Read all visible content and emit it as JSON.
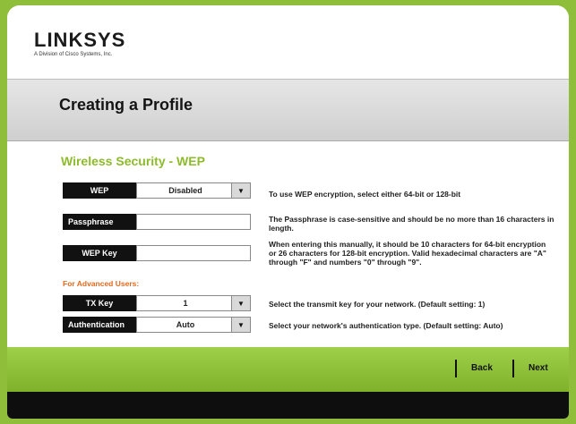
{
  "brand": {
    "name": "LINKSYS",
    "tagline": "A Division of Cisco Systems, Inc."
  },
  "page_title": "Creating a Profile",
  "section_title": "Wireless Security - WEP",
  "fields": {
    "security_mode": {
      "label": "WEP",
      "value": "Disabled",
      "help": "To use WEP encryption, select either 64-bit or 128-bit"
    },
    "passphrase": {
      "label": "Passphrase",
      "value": "",
      "help": "The Passphrase is case-sensitive and should be no more than 16 characters in length."
    },
    "wep_key": {
      "label": "WEP Key",
      "value": "",
      "help": "When entering this manually, it should be 10 characters for 64-bit encryption or 26 characters for 128-bit encryption. Valid hexadecimal characters are \"A\" through \"F\" and numbers \"0\" through \"9\"."
    },
    "advanced_heading": "For Advanced Users:",
    "tx_key": {
      "label": "TX Key",
      "value": "1",
      "help": "Select the transmit key for your network. (Default setting: 1)"
    },
    "authentication": {
      "label": "Authentication",
      "value": "Auto",
      "help": "Select your network's authentication type. (Default setting: Auto)"
    }
  },
  "nav": {
    "back": "Back",
    "next": "Next"
  },
  "icons": {
    "dropdown": "chevron-down-icon"
  },
  "colors": {
    "accent_green": "#8dbb2c",
    "advanced_orange": "#e06b1f"
  }
}
